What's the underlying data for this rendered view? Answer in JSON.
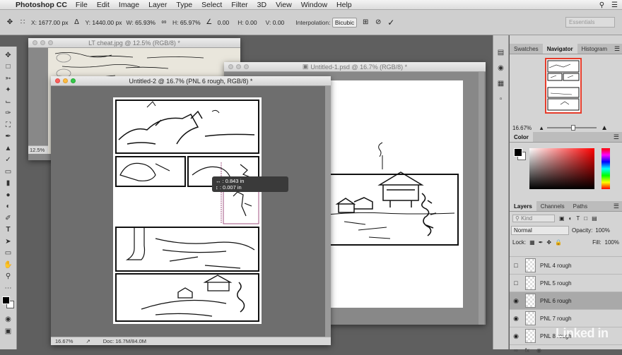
{
  "menubar": {
    "apple": "",
    "app_name": "Photoshop CC",
    "items": [
      "File",
      "Edit",
      "Image",
      "Layer",
      "Type",
      "Select",
      "Filter",
      "3D",
      "View",
      "Window",
      "Help"
    ]
  },
  "options_bar": {
    "x_label": "X:",
    "x_value": "1677.00 px",
    "y_label": "Y:",
    "y_value": "1440.00 px",
    "w_label": "W:",
    "w_value": "65.93%",
    "h_label": "H:",
    "h_value": "65.97%",
    "angle_value": "0.00",
    "hskew_label": "H:",
    "hskew_value": "0.00",
    "vskew_label": "V:",
    "vskew_value": "0.00",
    "interp_label": "Interpolation:",
    "interp_value": "Bicubic",
    "workspace": "Essentials"
  },
  "windows": {
    "cheat": {
      "title": "LT cheat.jpg @ 12.5% (RGB/8) *",
      "zoom": "12.5%"
    },
    "untitled1": {
      "title": "Untitled-1.psd @ 16.7% (RGB/8) *"
    },
    "untitled2": {
      "title": "Untitled-2 @ 16.7% (PNL 6 rough, RGB/8) *",
      "zoom": "16.67%",
      "doc": "Doc: 16.7M/84.0M"
    }
  },
  "transform_readout": {
    "w": "↔ : 0.843 in",
    "h": "↕ : 0.007 in"
  },
  "panels": {
    "top_tabs": [
      "Swatches",
      "Navigator",
      "Histogram"
    ],
    "nav_zoom": "16.67%",
    "color_tab": "Color",
    "layer_tabs": [
      "Layers",
      "Channels",
      "Paths"
    ],
    "kind": "Kind",
    "blend_mode": "Normal",
    "opacity_label": "Opacity:",
    "opacity_value": "100%",
    "lock_label": "Lock:",
    "fill_label": "Fill:",
    "fill_value": "100%",
    "layers": [
      {
        "name": "PNL 4 rough",
        "visible": false,
        "selected": false
      },
      {
        "name": "PNL 5 rough",
        "visible": false,
        "selected": false
      },
      {
        "name": "PNL 6 rough",
        "visible": true,
        "selected": true
      },
      {
        "name": "PNL 7 rough",
        "visible": true,
        "selected": false
      },
      {
        "name": "PNL 8 rough",
        "visible": true,
        "selected": false
      }
    ]
  },
  "watermark": "Linked in",
  "colors": {
    "fg": "#000000",
    "bg": "#ffffff",
    "selected_layer": "#a9a9a9"
  }
}
